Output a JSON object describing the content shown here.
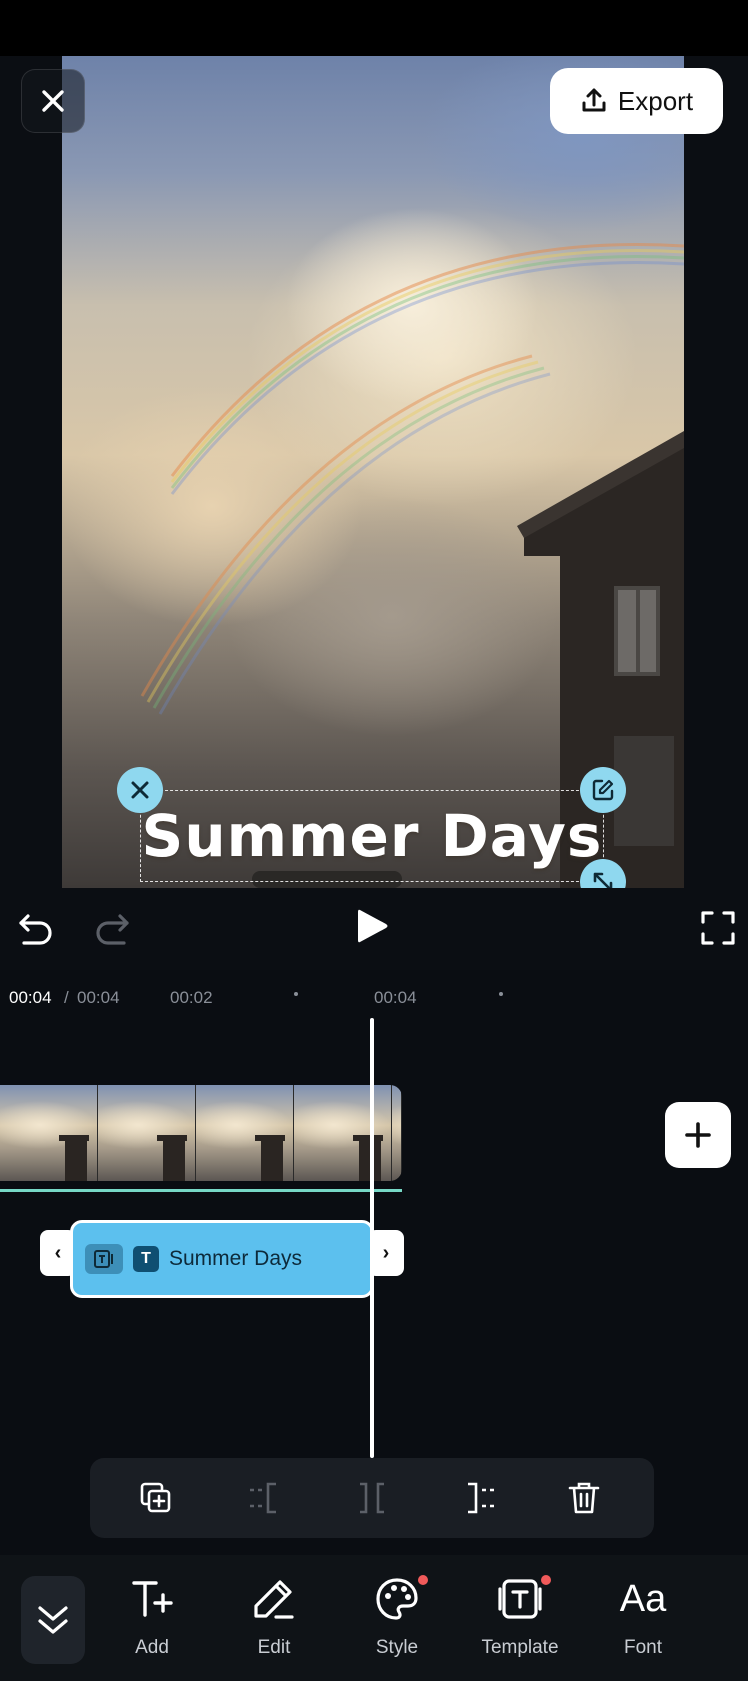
{
  "header": {
    "export_label": "Export"
  },
  "preview": {
    "overlay_text": "Summer Days"
  },
  "timeline": {
    "current_time": "00:04",
    "separator": "/",
    "total_time": "00:04",
    "ruler_marks": [
      "00:02",
      "00:04"
    ],
    "text_clip_label": "Summer Days",
    "text_clip_icon_letter": "T"
  },
  "toolbar": {
    "items": [
      {
        "label": "Add",
        "icon": "add-text-icon",
        "badge": false
      },
      {
        "label": "Edit",
        "icon": "pencil-icon",
        "badge": false
      },
      {
        "label": "Style",
        "icon": "palette-icon",
        "badge": true
      },
      {
        "label": "Template",
        "icon": "template-icon",
        "badge": true
      },
      {
        "label": "Font",
        "icon": "font-icon",
        "badge": false
      }
    ],
    "font_glyph": "Aa"
  },
  "colors": {
    "accent": "#5cc0ee",
    "handle": "#8fd8ef",
    "clip_line": "#77d8c6",
    "badge": "#f05a5a"
  }
}
